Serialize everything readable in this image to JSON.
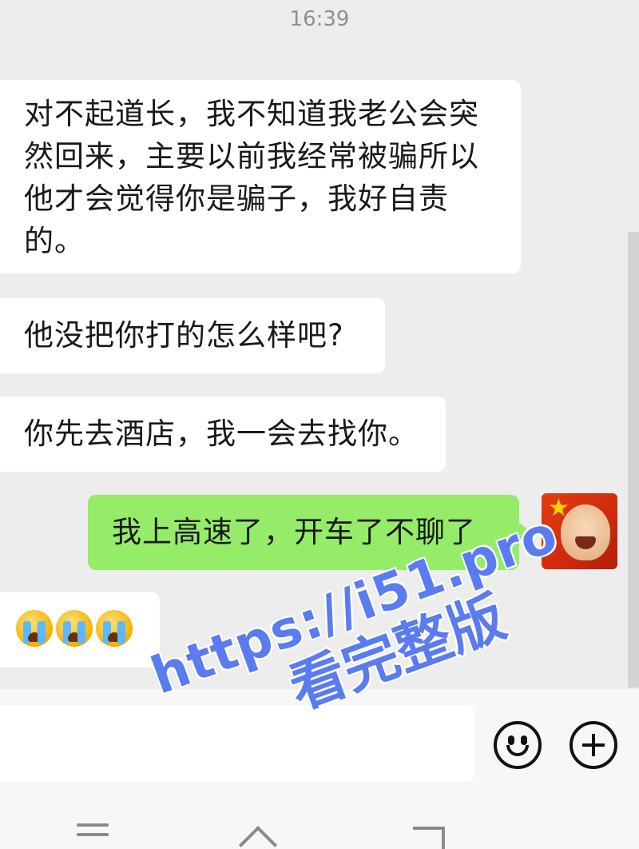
{
  "status": {
    "time": "16:39"
  },
  "messages": [
    {
      "side": "incoming",
      "text": "对不起道长，我不知道我老公会突然回来，主要以前我经常被骗所以他才会觉得你是骗子，我好自责的。"
    },
    {
      "side": "incoming",
      "text": "他没把你打的怎么样吧?"
    },
    {
      "side": "incoming",
      "text": "你先去酒店，我一会去找你。"
    },
    {
      "side": "outgoing",
      "text": "我上高速了，开车了不聊了"
    },
    {
      "side": "incoming",
      "emoji": [
        "loudly-crying-face",
        "loudly-crying-face",
        "loudly-crying-face"
      ]
    }
  ],
  "input_bar": {
    "text_value": "",
    "icons": [
      "smiley-icon",
      "plus-icon"
    ]
  },
  "nav_bar": {
    "icons": [
      "menu-icon",
      "home-icon",
      "back-icon"
    ]
  },
  "watermark": {
    "url": "https://i51.pro",
    "caption": "看完整版"
  },
  "colors": {
    "background": "#ededed",
    "incoming_bubble": "#ffffff",
    "outgoing_bubble": "#95ec69",
    "watermark": "#5a7cf0"
  }
}
